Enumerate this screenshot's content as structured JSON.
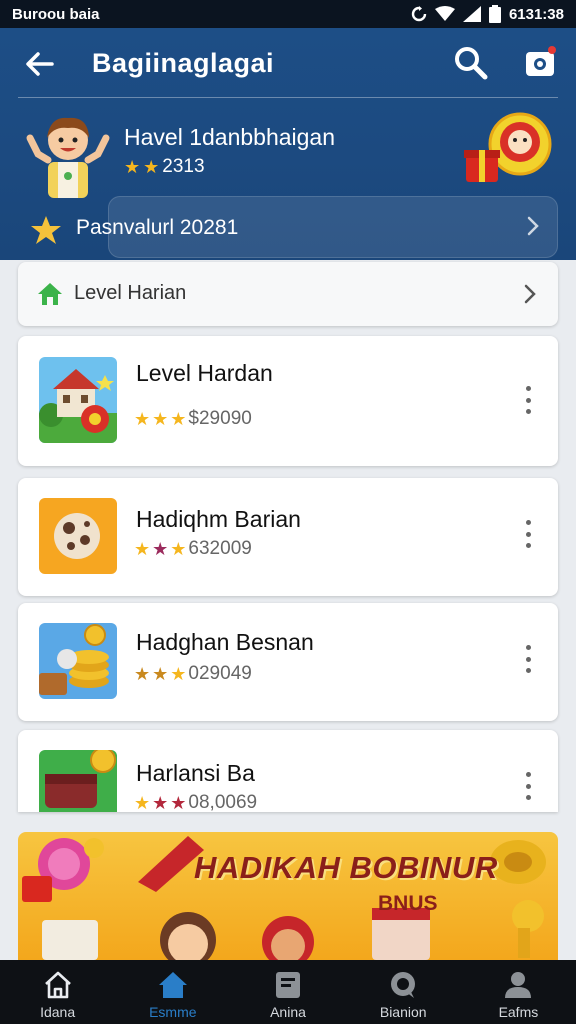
{
  "status_bar": {
    "carrier": "Buroou baia",
    "time": "6131:38"
  },
  "header": {
    "title": "Bagiinaglagai",
    "profile": {
      "name": "Havel 1danbbhaigan",
      "rating_value": "2313",
      "stars": 2
    },
    "pass": {
      "label": "Pasnvalurl 20281"
    }
  },
  "level_row": {
    "label": "Level Harian"
  },
  "cards": [
    {
      "title": "Level Hardan",
      "rating_value": "$29090",
      "stars": 3
    },
    {
      "title": "Hadiqhm Barian",
      "rating_value": "632009",
      "stars": 3
    },
    {
      "title": "Hadghan Besnan",
      "rating_value": "029049",
      "stars": 3
    },
    {
      "title": "Harlansi Ba",
      "rating_value": "08,0069",
      "stars": 3
    }
  ],
  "banner": {
    "line1": "HADIKAH BOBINUR",
    "line2": "BNUS"
  },
  "bottom_nav": [
    {
      "label": "Idana",
      "icon": "home-outline-icon"
    },
    {
      "label": "Esmme",
      "icon": "home-filled-icon",
      "active": true
    },
    {
      "label": "Anina",
      "icon": "notebook-icon"
    },
    {
      "label": "Bianion",
      "icon": "chat-icon"
    },
    {
      "label": "Eafms",
      "icon": "person-icon"
    }
  ],
  "colors": {
    "header_bg": "#1d4e86",
    "accent": "#2a7ec8",
    "star": "#f5b61e",
    "banner": "#f3a71c"
  }
}
